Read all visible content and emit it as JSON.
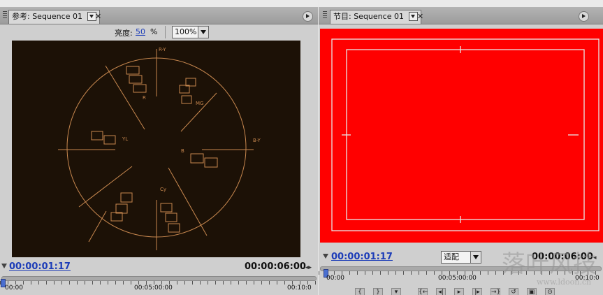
{
  "source_panel": {
    "tab_title": "参考: Sequence 01",
    "brightness_label": "亮度:",
    "brightness_value": "50",
    "brightness_unit": "%",
    "zoom_value": "100%",
    "current_timecode": "00:00:01:17",
    "duration_timecode": "00:00:06:00",
    "ruler_labels": [
      "00:00",
      "00:05:00:00",
      "00:10:0"
    ],
    "vectorscope_labels": {
      "top": "R-Y",
      "right": "B-Y",
      "r": "R",
      "mg": "MG",
      "yl": "YL",
      "b": "B",
      "cy": "Cy"
    }
  },
  "program_panel": {
    "tab_title": "节目: Sequence 01",
    "fit_value": "适配",
    "current_timecode": "00:00:01:17",
    "duration_timecode": "00:00:06:00",
    "ruler_labels": [
      "00:00",
      "00:05:00:00",
      "00:10:0"
    ],
    "frame_color": "#ff0000",
    "safe_margin_color": "#e8e8e8"
  },
  "watermark": {
    "text": "落叶风技",
    "url": "www.ldoon.cn"
  }
}
